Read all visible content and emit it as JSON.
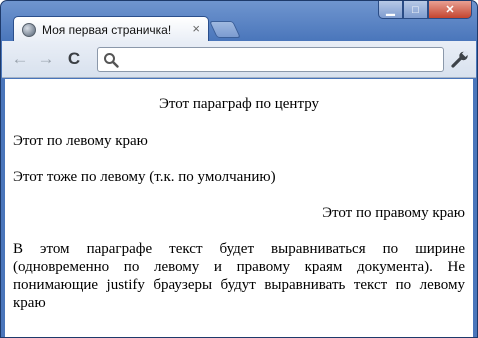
{
  "tab": {
    "title": "Моя первая страничка!",
    "close_label": "×"
  },
  "window_controls": {
    "minimize": "▁",
    "maximize": "□",
    "close": "✕"
  },
  "toolbar": {
    "back_icon": "←",
    "forward_icon": "→",
    "reload_icon": "C",
    "address_value": "",
    "address_placeholder": ""
  },
  "content": {
    "paragraphs": [
      "Этот параграф по центру",
      "Этот по левому краю",
      "Этот тоже по левому (т.к. по умолчанию)",
      "Этот по правому краю",
      "В этом параграфе текст будет выравниваться по ширине (одновременно по левому и правому краям документа). Не понимающие justify браузеры будут выравнивать текст по левому краю"
    ]
  },
  "colors": {
    "frame": "#4a76bb",
    "toolbar": "#dfe6f1"
  }
}
